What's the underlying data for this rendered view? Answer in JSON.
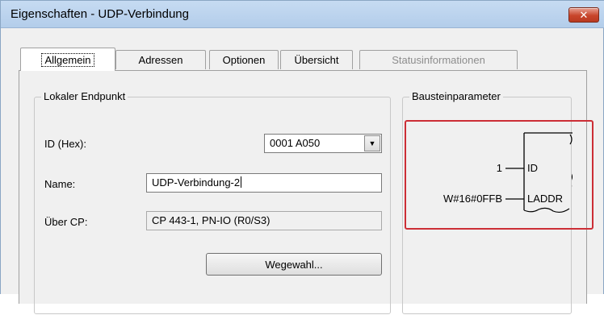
{
  "window": {
    "title": "Eigenschaften - UDP-Verbindung",
    "close_glyph": "✕"
  },
  "tabs": [
    {
      "label": "Allgemein",
      "active": true,
      "enabled": true
    },
    {
      "label": "Adressen",
      "active": false,
      "enabled": true
    },
    {
      "label": "Optionen",
      "active": false,
      "enabled": true
    },
    {
      "label": "Übersicht",
      "active": false,
      "enabled": true
    },
    {
      "label": "Statusinformationen",
      "active": false,
      "enabled": false
    }
  ],
  "local_endpoint": {
    "group_title": "Lokaler Endpunkt",
    "id_label": "ID (Hex):",
    "id_value": "0001 A050",
    "name_label": "Name:",
    "name_value": "UDP-Verbindung-2",
    "cp_label": "Über CP:",
    "cp_value": "CP 443-1, PN-IO (R0/S3)",
    "route_button": "Wegewahl..."
  },
  "block_params": {
    "group_title": "Bausteinparameter",
    "id_input_value": "1",
    "id_pin": "ID",
    "laddr_input_value": "W#16#0FFB",
    "laddr_pin": "LADDR"
  },
  "colors": {
    "highlight": "#cc2e36",
    "close_button": "#c8452b"
  },
  "icons": {
    "close": "close-icon",
    "dropdown": "chevron-down-icon"
  }
}
